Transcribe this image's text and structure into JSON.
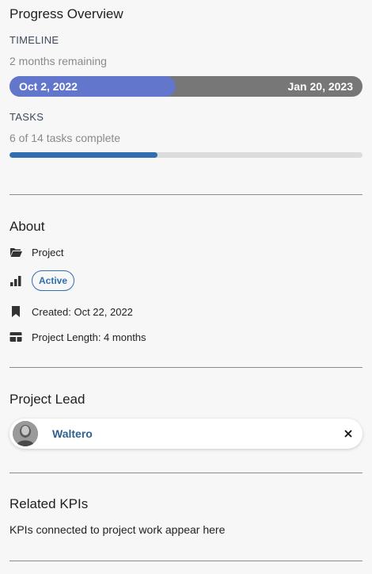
{
  "progress": {
    "title": "Progress Overview",
    "timeline": {
      "label": "TIMELINE",
      "remaining": "2 months remaining",
      "start": "Oct 2, 2022",
      "end": "Jan 20, 2023",
      "fill_fraction": 0.47,
      "fill_color": "#6277cc",
      "track_color": "#777777"
    },
    "tasks": {
      "label": "TASKS",
      "summary": "6 of 14 tasks complete",
      "fill_fraction": 0.42,
      "fill_color": "#2f6fb0"
    }
  },
  "about": {
    "title": "About",
    "items": [
      {
        "icon": "folder-open-icon",
        "text": "Project"
      },
      {
        "icon": "bar-chart-icon",
        "badge": "Active"
      },
      {
        "icon": "bookmark-icon",
        "text": "Created: Oct 22, 2022"
      },
      {
        "icon": "card-icon",
        "text": "Project Length: 4 months"
      }
    ]
  },
  "lead": {
    "title": "Project Lead",
    "name": "Waltero",
    "remove_icon": "close-icon"
  },
  "kpis": {
    "title": "Related KPIs",
    "empty_text": "KPIs connected to project work appear here"
  }
}
